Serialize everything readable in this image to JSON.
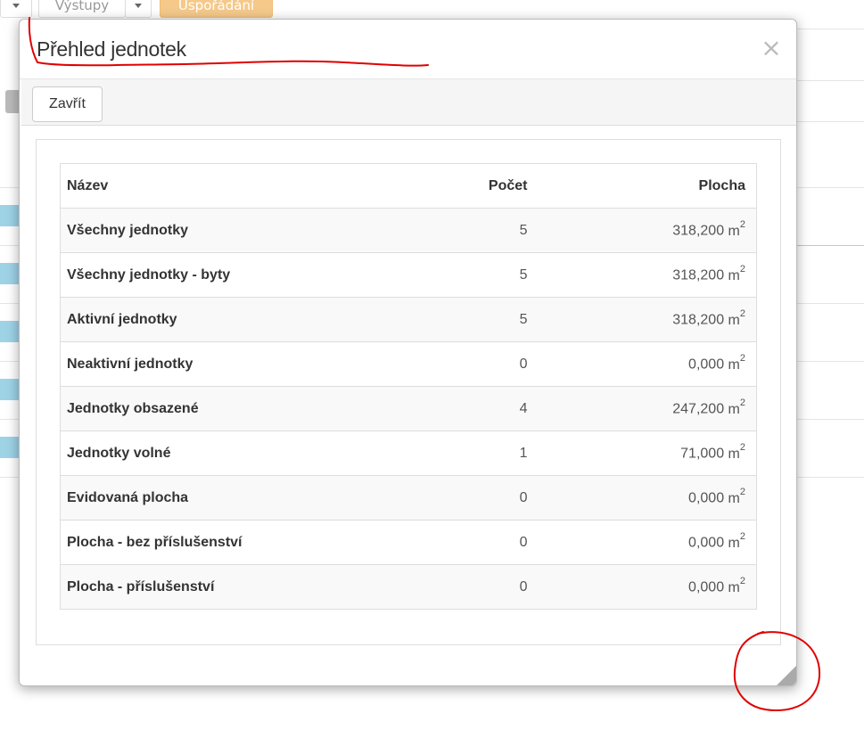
{
  "background": {
    "toolbar": {
      "outputs_label": "Výstupy",
      "arrange_label": "Uspořádání"
    },
    "colors": {
      "accent_orange": "#f5c98a",
      "row_blue": "#9ed3e6"
    }
  },
  "modal": {
    "title": "Přehled jednotek",
    "close_icon": "close-icon",
    "toolbar": {
      "close_label": "Zavřít"
    },
    "table": {
      "headers": {
        "name": "Název",
        "count": "Počet",
        "area": "Plocha"
      },
      "unit": "m",
      "unit_exp": "2",
      "rows": [
        {
          "name": "Všechny jednotky",
          "count": "5",
          "area": "318,200"
        },
        {
          "name": "Všechny jednotky - byty",
          "count": "5",
          "area": "318,200"
        },
        {
          "name": "Aktivní jednotky",
          "count": "5",
          "area": "318,200"
        },
        {
          "name": "Neaktivní jednotky",
          "count": "0",
          "area": "0,000"
        },
        {
          "name": "Jednotky obsazené",
          "count": "4",
          "area": "247,200"
        },
        {
          "name": "Jednotky volné",
          "count": "1",
          "area": "71,000"
        },
        {
          "name": "Evidovaná plocha",
          "count": "0",
          "area": "0,000"
        },
        {
          "name": "Plocha - bez příslušenství",
          "count": "0",
          "area": "0,000"
        },
        {
          "name": "Plocha - příslušenství",
          "count": "0",
          "area": "0,000"
        }
      ]
    },
    "resize_icon": "resize-handle-icon"
  },
  "annotation_color": "#e00000"
}
